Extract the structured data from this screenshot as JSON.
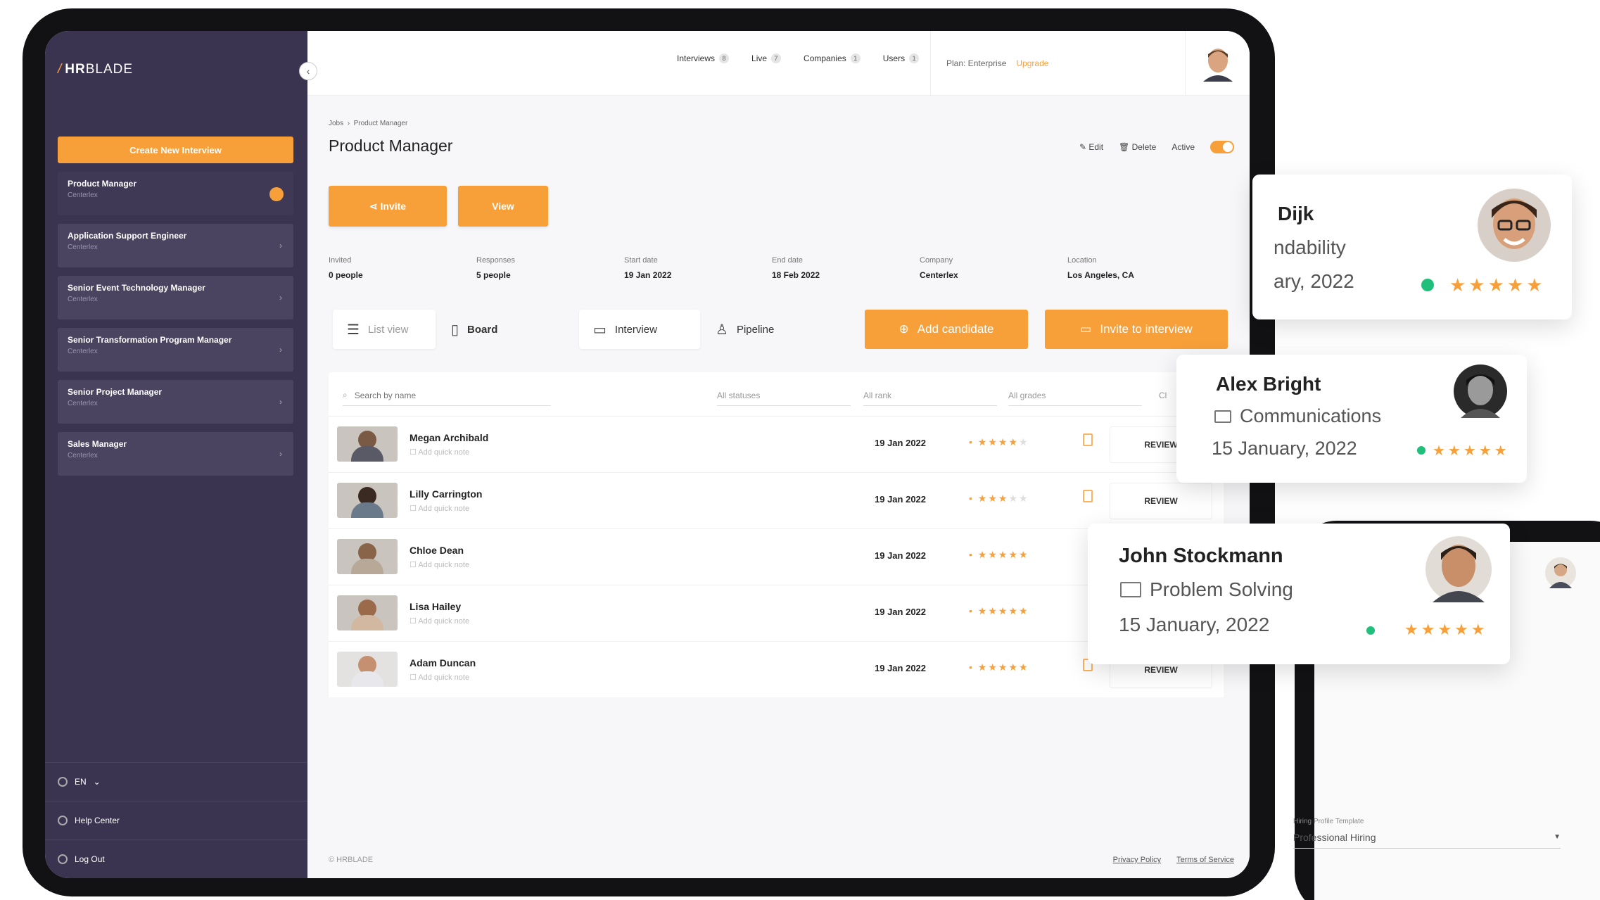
{
  "app": {
    "logo_slash": "/",
    "logo_bold": "HR",
    "logo_rest": "BLADE"
  },
  "sidebar": {
    "create_label": "Create New Interview",
    "jobs": [
      {
        "title": "Product Manager",
        "company": "Centerlex"
      },
      {
        "title": "Application Support Engineer",
        "company": "Centerlex"
      },
      {
        "title": "Senior Event Technology Manager",
        "company": "Centerlex"
      },
      {
        "title": "Senior Transformation Program Manager",
        "company": "Centerlex"
      },
      {
        "title": "Senior Project Manager",
        "company": "Centerlex"
      },
      {
        "title": "Sales Manager",
        "company": "Centerlex"
      }
    ],
    "language": "EN",
    "help": "Help Center",
    "logout": "Log Out"
  },
  "topbar": {
    "nav": [
      {
        "label": "Interviews",
        "count": "8"
      },
      {
        "label": "Live",
        "count": "7"
      },
      {
        "label": "Companies",
        "count": "1"
      },
      {
        "label": "Users",
        "count": "1"
      }
    ],
    "plan": "Plan: Enterprise",
    "upgrade": "Upgrade"
  },
  "job": {
    "breadcrumb_root": "Jobs",
    "breadcrumb_sep": "›",
    "breadcrumb_current": "Product Manager",
    "title": "Product Manager",
    "edit": "Edit",
    "delete": "Delete",
    "active": "Active",
    "invite": "Invite",
    "view": "View",
    "stats": [
      {
        "label": "Invited",
        "value": "0 people"
      },
      {
        "label": "Responses",
        "value": "5 people"
      },
      {
        "label": "Start date",
        "value": "19 Jan 2022"
      },
      {
        "label": "End date",
        "value": "18 Feb 2022"
      },
      {
        "label": "Company",
        "value": "Centerlex"
      },
      {
        "label": "Location",
        "value": "Los Angeles, CA"
      }
    ]
  },
  "views": {
    "list": "List view",
    "board": "Board",
    "interview": "Interview",
    "pipeline": "Pipeline",
    "add_candidate": "Add candidate",
    "invite_interview": "Invite to interview"
  },
  "filters": {
    "search_placeholder": "Search by name",
    "statuses": "All statuses",
    "rank": "All rank",
    "grades": "All grades",
    "extra": "Cl"
  },
  "candidates": [
    {
      "name": "Megan Archibald",
      "note": "Add quick note",
      "date": "19 Jan 2022",
      "rating": 4,
      "review": "REVIEW"
    },
    {
      "name": "Lilly Carrington",
      "note": "Add quick note",
      "date": "19 Jan 2022",
      "rating": 3,
      "review": "REVIEW"
    },
    {
      "name": "Chloe Dean",
      "note": "Add quick note",
      "date": "19 Jan 2022",
      "rating": 5,
      "review": ""
    },
    {
      "name": "Lisa Hailey",
      "note": "Add quick note",
      "date": "19 Jan 2022",
      "rating": 5,
      "review": ""
    },
    {
      "name": "Adam Duncan",
      "note": "Add quick note",
      "date": "19 Jan 2022",
      "rating": 5,
      "review": "REVIEW"
    }
  ],
  "footer": {
    "copyright": "© HRBLADE",
    "privacy": "Privacy Policy",
    "terms": "Terms of Service"
  },
  "cards": {
    "dijk": {
      "name": "Dijk",
      "skill": "ndability",
      "date": "ary, 2022",
      "rating": 5
    },
    "alex": {
      "name": "Alex Bright",
      "skill": "Communications",
      "date": "15 January, 2022",
      "rating": 5
    },
    "john": {
      "name": "John Stockmann",
      "skill": "Problem Solving",
      "date": "15 January, 2022",
      "rating": 5
    }
  },
  "device2": {
    "profile_label": "Hiring Profile Template",
    "profile_value": "Professional Hiring"
  },
  "colors": {
    "accent": "#f7a03a",
    "sidebar": "#3a3450",
    "good": "#21c07a"
  }
}
